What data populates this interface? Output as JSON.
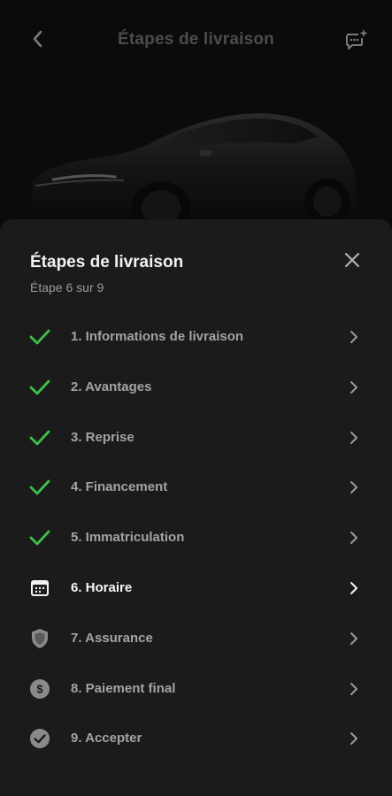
{
  "header": {
    "title": "Étapes de livraison",
    "back_icon": "chevron-left-icon",
    "chat_icon": "chat-sparkle-icon"
  },
  "sheet": {
    "title": "Étapes de livraison",
    "subtitle": "Étape 6 sur 9",
    "close_icon": "close-icon"
  },
  "steps": [
    {
      "label": "1. Informations de livraison",
      "status": "done",
      "icon": "check-icon"
    },
    {
      "label": "2. Avantages",
      "status": "done",
      "icon": "check-icon"
    },
    {
      "label": "3. Reprise",
      "status": "done",
      "icon": "check-icon"
    },
    {
      "label": "4. Financement",
      "status": "done",
      "icon": "check-icon"
    },
    {
      "label": "5. Immatriculation",
      "status": "done",
      "icon": "check-icon"
    },
    {
      "label": "6. Horaire",
      "status": "current",
      "icon": "calendar-icon"
    },
    {
      "label": "7. Assurance",
      "status": "upcoming",
      "icon": "shield-icon"
    },
    {
      "label": "8. Paiement final",
      "status": "upcoming",
      "icon": "dollar-icon"
    },
    {
      "label": "9. Accepter",
      "status": "upcoming",
      "icon": "check-circle-icon"
    }
  ],
  "colors": {
    "background": "#0b0b0b",
    "sheet": "#1b1b1b",
    "check": "#3fbf4a",
    "muted_text": "#a3a3a3",
    "active_text": "#f5f5f5"
  }
}
